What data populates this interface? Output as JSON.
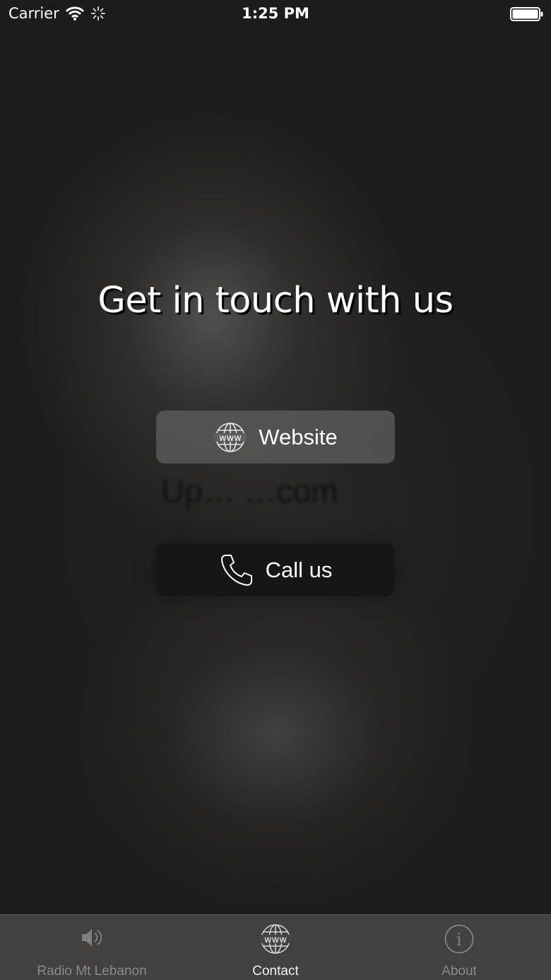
{
  "status_bar": {
    "carrier": "Carrier",
    "time": "1:25 PM",
    "icons": [
      "wifi-icon",
      "activity-indicator-icon",
      "battery-icon"
    ]
  },
  "main": {
    "headline": "Get in touch with us",
    "website_button": {
      "label": "Website",
      "icon": "globe-www-icon"
    },
    "call_button": {
      "label": "Call us",
      "icon": "phone-icon"
    },
    "ghost_text": "Up… …com"
  },
  "tab_bar": {
    "tabs": [
      {
        "label": "Radio Mt Lebanon",
        "icon": "speaker-icon",
        "selected": false
      },
      {
        "label": "Contact",
        "icon": "globe-www-icon",
        "selected": true
      },
      {
        "label": "About",
        "icon": "info-icon",
        "selected": false
      }
    ]
  },
  "colors": {
    "background": "#1c1c1c",
    "text": "#ffffff",
    "tab_selected": "#f2f2f2",
    "tab_unselected": "#8a8a8a"
  }
}
